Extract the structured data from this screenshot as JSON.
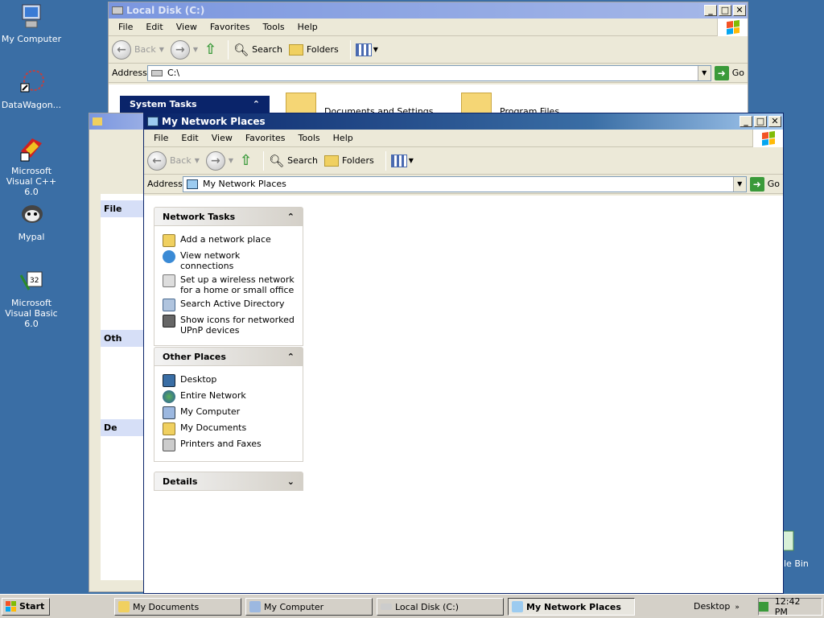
{
  "desktop": {
    "icons": [
      {
        "label": "My Computer",
        "icon": "computer-icon"
      },
      {
        "label": "DataWagon...",
        "icon": "datawagon-icon"
      },
      {
        "label": "Microsoft Visual C++ 6.0",
        "icon": "visual-cpp-icon"
      },
      {
        "label": "Mypal",
        "icon": "mypal-icon"
      },
      {
        "label": "Microsoft Visual Basic 6.0",
        "icon": "visual-basic-icon"
      },
      {
        "label": "le Bin",
        "icon": "recycle-bin-icon"
      }
    ]
  },
  "back_window": {
    "title": "Local Disk (C:)",
    "menu": [
      "File",
      "Edit",
      "View",
      "Favorites",
      "Tools",
      "Help"
    ],
    "toolbar": {
      "back": "Back",
      "search": "Search",
      "folders": "Folders"
    },
    "address_label": "Address",
    "address_value": "C:\\",
    "go": "Go",
    "system_tasks": "System Tasks",
    "files": [
      "Documents and Settings",
      "Program Files"
    ],
    "side_headers": [
      "File",
      "Oth",
      "De"
    ]
  },
  "front_window": {
    "title": "My Network Places",
    "menu": [
      "File",
      "Edit",
      "View",
      "Favorites",
      "Tools",
      "Help"
    ],
    "toolbar": {
      "back": "Back",
      "search": "Search",
      "folders": "Folders"
    },
    "address_label": "Address",
    "address_value": "My Network Places",
    "go": "Go",
    "network_tasks": {
      "title": "Network Tasks",
      "items": [
        "Add a network place",
        "View network connections",
        "Set up a wireless network for a home or small office",
        "Search Active Directory",
        "Show icons for networked UPnP devices"
      ]
    },
    "other_places": {
      "title": "Other Places",
      "items": [
        "Desktop",
        "Entire Network",
        "My Computer",
        "My Documents",
        "Printers and Faxes"
      ]
    },
    "details": {
      "title": "Details"
    }
  },
  "taskbar": {
    "start": "Start",
    "tasks": [
      "My Documents",
      "My Computer",
      "Local Disk (C:)",
      "My Network Places"
    ],
    "toolbar_label": "Desktop",
    "clock": "12:42 PM"
  },
  "colors": {
    "desktop": "#3a6ea5",
    "titlebar_active": "#0a246a",
    "task_link": "#215dc6"
  }
}
